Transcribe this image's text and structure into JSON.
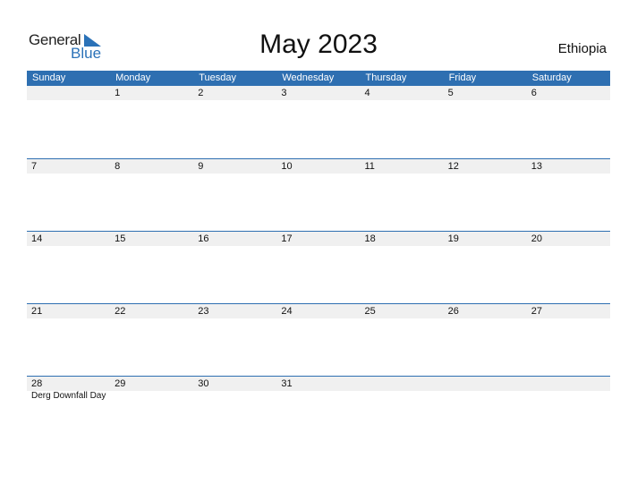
{
  "logo": {
    "general": "General",
    "blue": "Blue"
  },
  "title": "May 2023",
  "country": "Ethiopia",
  "colors": {
    "accent": "#2e6fb1",
    "strip": "#f0f0f0"
  },
  "weekdays": [
    "Sunday",
    "Monday",
    "Tuesday",
    "Wednesday",
    "Thursday",
    "Friday",
    "Saturday"
  ],
  "weeks": [
    [
      "",
      "1",
      "2",
      "3",
      "4",
      "5",
      "6"
    ],
    [
      "7",
      "8",
      "9",
      "10",
      "11",
      "12",
      "13"
    ],
    [
      "14",
      "15",
      "16",
      "17",
      "18",
      "19",
      "20"
    ],
    [
      "21",
      "22",
      "23",
      "24",
      "25",
      "26",
      "27"
    ],
    [
      "28",
      "29",
      "30",
      "31",
      "",
      "",
      ""
    ]
  ],
  "holidays": [
    {
      "date": "28",
      "name": "Derg Downfall Day"
    }
  ]
}
